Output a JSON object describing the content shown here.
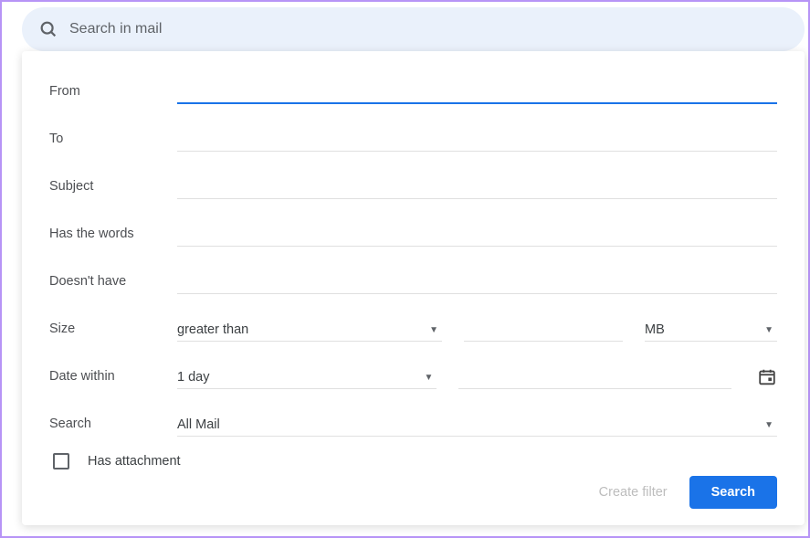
{
  "search": {
    "placeholder": "Search in mail"
  },
  "form": {
    "from": {
      "label": "From",
      "value": ""
    },
    "to": {
      "label": "To",
      "value": ""
    },
    "subject": {
      "label": "Subject",
      "value": ""
    },
    "has_words": {
      "label": "Has the words",
      "value": ""
    },
    "doesnt_have": {
      "label": "Doesn't have",
      "value": ""
    },
    "size": {
      "label": "Size",
      "comparator": "greater than",
      "amount": "",
      "unit": "MB"
    },
    "date": {
      "label": "Date within",
      "range": "1 day",
      "value": ""
    },
    "search_in": {
      "label": "Search",
      "value": "All Mail"
    },
    "attachment": {
      "label": "Has attachment",
      "checked": false
    }
  },
  "footer": {
    "create_filter": "Create filter",
    "search": "Search"
  }
}
